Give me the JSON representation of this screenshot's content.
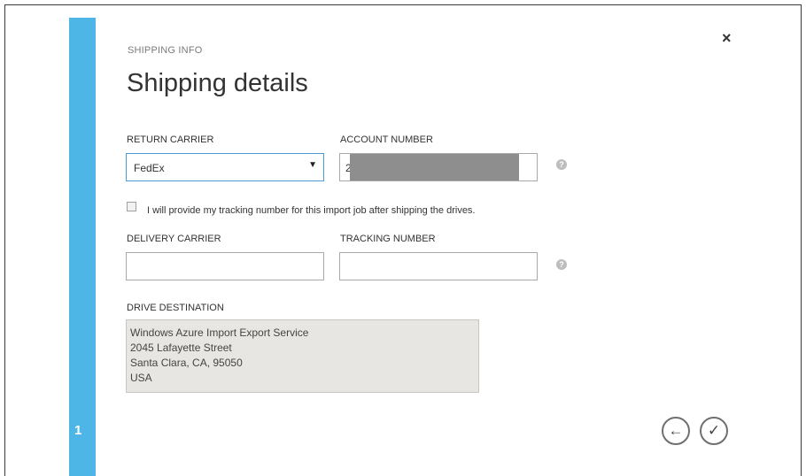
{
  "dialog": {
    "section_label": "SHIPPING INFO",
    "title": "Shipping details",
    "close_glyph": "×",
    "step_number": "1"
  },
  "return_carrier": {
    "label": "RETURN CARRIER",
    "value": "FedEx",
    "arrow": "▼"
  },
  "account_number": {
    "label": "ACCOUNT NUMBER",
    "value_visible": "2"
  },
  "tracking_checkbox": {
    "label": "I will provide my tracking number for this import job after shipping the drives.",
    "checked": false
  },
  "delivery_carrier": {
    "label": "DELIVERY CARRIER",
    "value": ""
  },
  "tracking_number": {
    "label": "TRACKING NUMBER",
    "value": ""
  },
  "drive_destination": {
    "label": "DRIVE DESTINATION",
    "lines": [
      "Windows Azure Import Export Service",
      "2045 Lafayette Street",
      "Santa Clara, CA, 95050",
      "USA"
    ]
  },
  "help_glyph": "?",
  "nav": {
    "back_glyph": "←",
    "finish_glyph": "✓"
  },
  "colors": {
    "accent": "#4db6e6",
    "select_border": "#4a9bd8",
    "redaction": "#8e8e8e",
    "destination_bg": "#e8e6e2"
  },
  "icons": [
    "close-icon",
    "help-icon",
    "back-arrow-icon",
    "checkmark-icon",
    "dropdown-arrow-icon"
  ]
}
